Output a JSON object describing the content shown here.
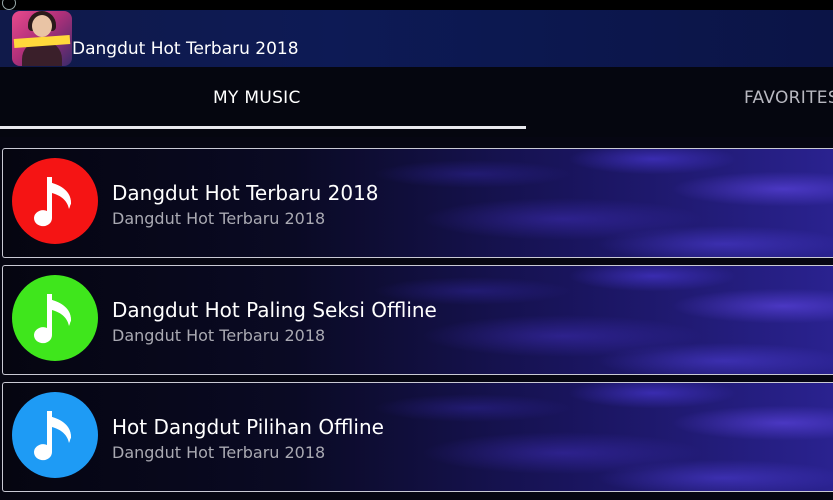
{
  "app": {
    "title": "Dangdut Hot Terbaru 2018",
    "icon": "app-cover-icon"
  },
  "tabs": [
    {
      "label": "MY MUSIC",
      "selected": true
    },
    {
      "label": "FAVORITES",
      "selected": false
    }
  ],
  "songs": [
    {
      "title": "Dangdut Hot Terbaru 2018",
      "subtitle": "Dangdut Hot Terbaru 2018",
      "icon": "music-note-icon",
      "icon_color": "#f51414"
    },
    {
      "title": "Dangdut Hot Paling Seksi Offline",
      "subtitle": "Dangdut Hot Terbaru 2018",
      "icon": "music-note-icon",
      "icon_color": "#3fe61c"
    },
    {
      "title": "Hot Dangdut Pilihan Offline",
      "subtitle": "Dangdut Hot Terbaru 2018",
      "icon": "music-note-icon",
      "icon_color": "#1e9bf5"
    }
  ]
}
